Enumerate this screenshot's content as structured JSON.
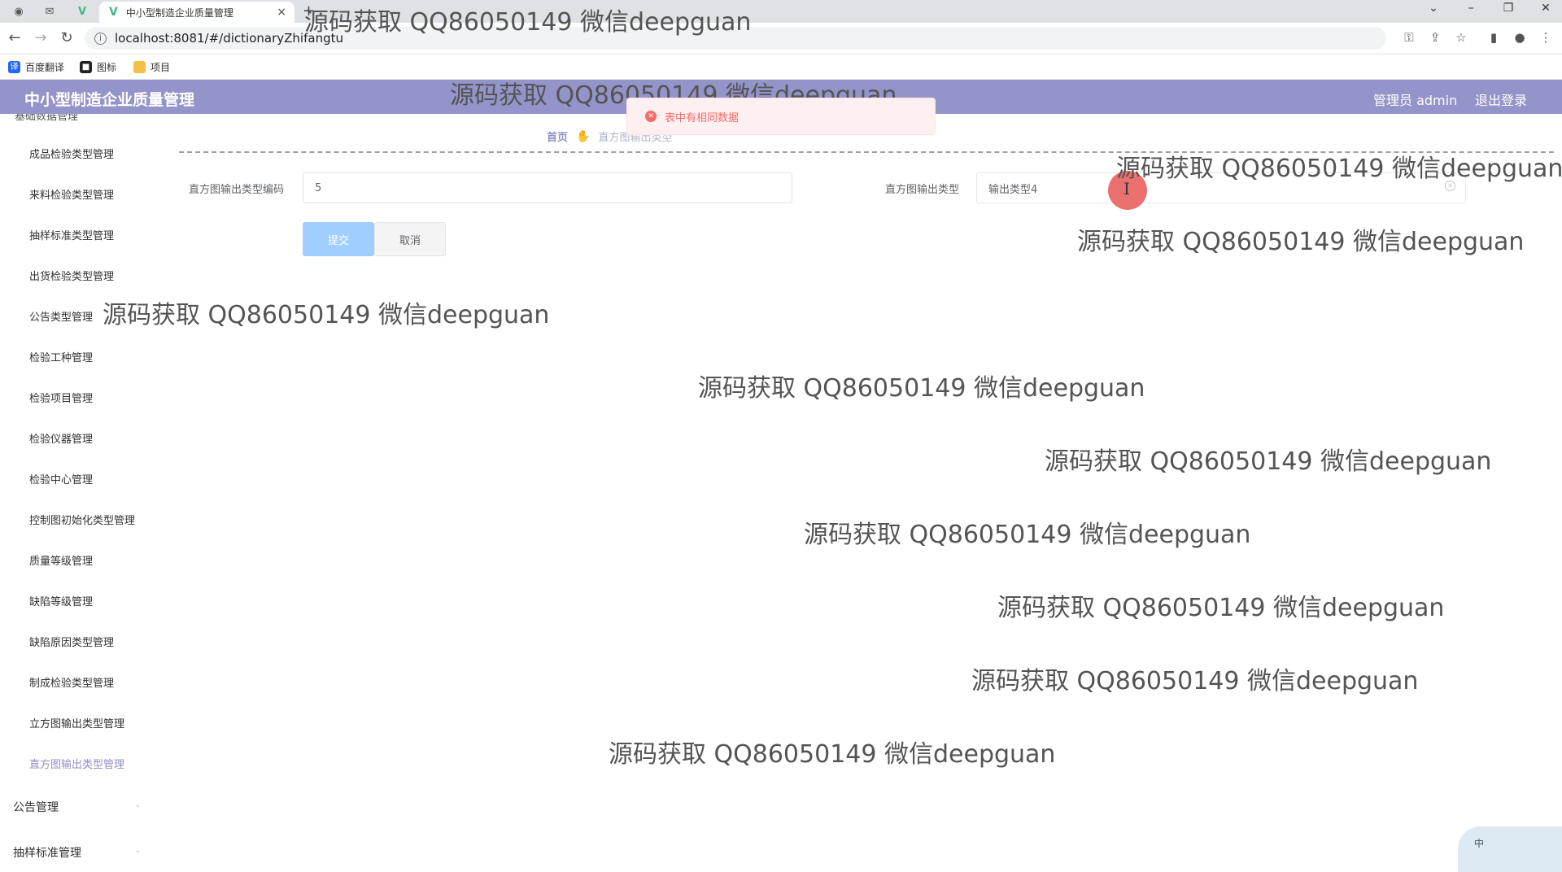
{
  "browser": {
    "tab_title": "中小型制造企业质量管理",
    "tab_close": "×",
    "new_tab": "+",
    "url": "localhost:8081/#/dictionaryZhifangtu",
    "bookmarks": [
      {
        "icon_text": "译",
        "label": "百度翻译",
        "color": "#2468f2"
      },
      {
        "icon_text": "■",
        "label": "图标",
        "color": "#222222"
      },
      {
        "icon_text": "",
        "label": "项目",
        "color": "#f3c14a"
      }
    ]
  },
  "header": {
    "title": "中小型制造企业质量管理",
    "admin": "管理员 admin",
    "logout": "退出登录",
    "color": "#9394c9"
  },
  "sidebar": {
    "clipped_label": "基础数据管理",
    "items": [
      "成品检验类型管理",
      "来料检验类型管理",
      "抽样标准类型管理",
      "出货检验类型管理",
      "公告类型管理",
      "检验工种管理",
      "检验项目管理",
      "检验仪器管理",
      "检验中心管理",
      "控制图初始化类型管理",
      "质量等级管理",
      "缺陷等级管理",
      "缺陷原因类型管理",
      "制成检验类型管理",
      "立方图输出类型管理",
      "直方图输出类型管理"
    ],
    "active_index": 15,
    "groups": [
      "公告管理",
      "抽样标准管理"
    ]
  },
  "breadcrumb": {
    "home": "首页",
    "current": "直方图输出类型"
  },
  "form": {
    "code_label": "直方图输出类型编码",
    "code_value": "5",
    "type_label": "直方图输出类型",
    "type_value": "输出类型4",
    "submit": "提交",
    "cancel": "取消"
  },
  "message": {
    "text": "表中有相同数据",
    "color": "#f56c6c"
  },
  "widget": {
    "text": "中"
  },
  "watermark": "源码获取 QQ86050149 微信deepguan"
}
